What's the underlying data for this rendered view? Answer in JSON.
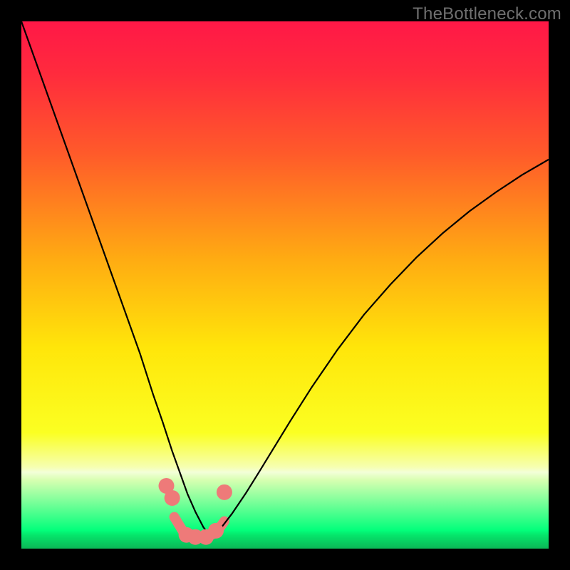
{
  "watermark": "TheBottleneck.com",
  "chart_data": {
    "type": "line",
    "title": "",
    "xlabel": "",
    "ylabel": "",
    "xlim": [
      0,
      100
    ],
    "ylim": [
      0,
      100
    ],
    "grid": false,
    "legend": false,
    "gradient_stops": [
      {
        "offset": 0.0,
        "color": "#ff1847"
      },
      {
        "offset": 0.1,
        "color": "#ff2b3d"
      },
      {
        "offset": 0.25,
        "color": "#ff5a2a"
      },
      {
        "offset": 0.45,
        "color": "#ffab12"
      },
      {
        "offset": 0.62,
        "color": "#ffe60a"
      },
      {
        "offset": 0.78,
        "color": "#fbff22"
      },
      {
        "offset": 0.845,
        "color": "#f6ffb0"
      },
      {
        "offset": 0.855,
        "color": "#f3ffd8"
      },
      {
        "offset": 0.87,
        "color": "#d7ffb1"
      },
      {
        "offset": 0.965,
        "color": "#03ff7b"
      },
      {
        "offset": 0.975,
        "color": "#05e46a"
      },
      {
        "offset": 1.0,
        "color": "#0bb757"
      }
    ],
    "series": [
      {
        "name": "left-curve",
        "stroke": "#000000",
        "stroke_width": 2.2,
        "x": [
          0.0,
          2.5,
          5.0,
          7.5,
          10.0,
          12.5,
          15.0,
          17.5,
          20.0,
          22.5,
          25.0,
          26.8,
          28.6,
          30.0,
          31.5,
          33.0,
          34.5,
          36.0
        ],
        "y": [
          100,
          93.0,
          86.0,
          79.0,
          72.0,
          65.0,
          58.0,
          51.0,
          44.0,
          37.0,
          29.2,
          24.0,
          18.5,
          14.6,
          10.4,
          7.0,
          4.1,
          2.1
        ]
      },
      {
        "name": "right-curve",
        "stroke": "#000000",
        "stroke_width": 2.2,
        "x": [
          36.0,
          38.0,
          40.0,
          42.5,
          45.0,
          48.0,
          51.0,
          55.0,
          60.0,
          65.0,
          70.0,
          75.0,
          80.0,
          85.0,
          90.0,
          95.0,
          100.0
        ],
        "y": [
          2.1,
          4.1,
          6.7,
          10.4,
          14.4,
          19.3,
          24.2,
          30.5,
          37.8,
          44.4,
          50.1,
          55.3,
          59.9,
          64.0,
          67.6,
          70.9,
          73.8
        ]
      },
      {
        "name": "marker-points",
        "type": "scatter",
        "color": "#ee7a79",
        "radius": 11,
        "x": [
          27.5,
          28.6,
          31.3,
          33.0,
          35.0,
          36.9,
          38.5
        ],
        "y": [
          11.9,
          9.6,
          2.6,
          2.2,
          2.2,
          3.4,
          10.7
        ]
      },
      {
        "name": "bottom-connector",
        "stroke": "#ee7a79",
        "stroke_width": 14,
        "linecap": "round",
        "x": [
          29.0,
          31.0,
          33.2,
          35.2,
          37.0,
          38.5
        ],
        "y": [
          6.0,
          2.7,
          2.2,
          2.2,
          3.1,
          5.2
        ]
      }
    ]
  }
}
